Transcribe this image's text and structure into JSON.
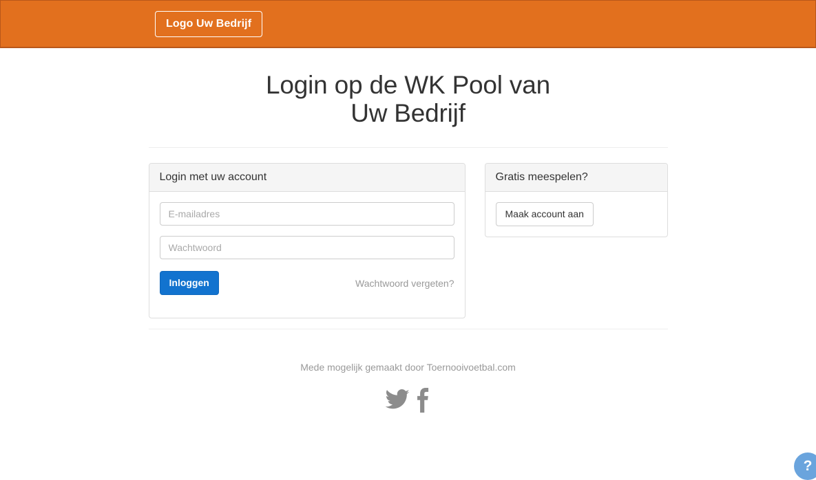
{
  "header": {
    "logo_label": "Logo Uw Bedrijf",
    "background_color": "#e2701e",
    "border_color": "#b9571a"
  },
  "page": {
    "title_line1": "Login op de WK Pool van",
    "title_line2": "Uw Bedrijf"
  },
  "login_panel": {
    "heading": "Login met uw account",
    "email_placeholder": "E-mailadres",
    "email_value": "",
    "password_placeholder": "Wachtwoord",
    "password_value": "",
    "submit_label": "Inloggen",
    "forgot_label": "Wachtwoord vergeten?",
    "submit_color": "#1273cf"
  },
  "signup_panel": {
    "heading": "Gratis meespelen?",
    "create_account_label": "Maak account aan"
  },
  "footer": {
    "credit": "Mede mogelijk gemaakt door Toernooivoetbal.com",
    "social": [
      {
        "name": "twitter-icon",
        "label": "Twitter"
      },
      {
        "name": "facebook-icon",
        "label": "Facebook"
      }
    ],
    "icon_color": "#8c8c8c"
  },
  "help": {
    "label": "?",
    "color": "#6aa4dd"
  }
}
